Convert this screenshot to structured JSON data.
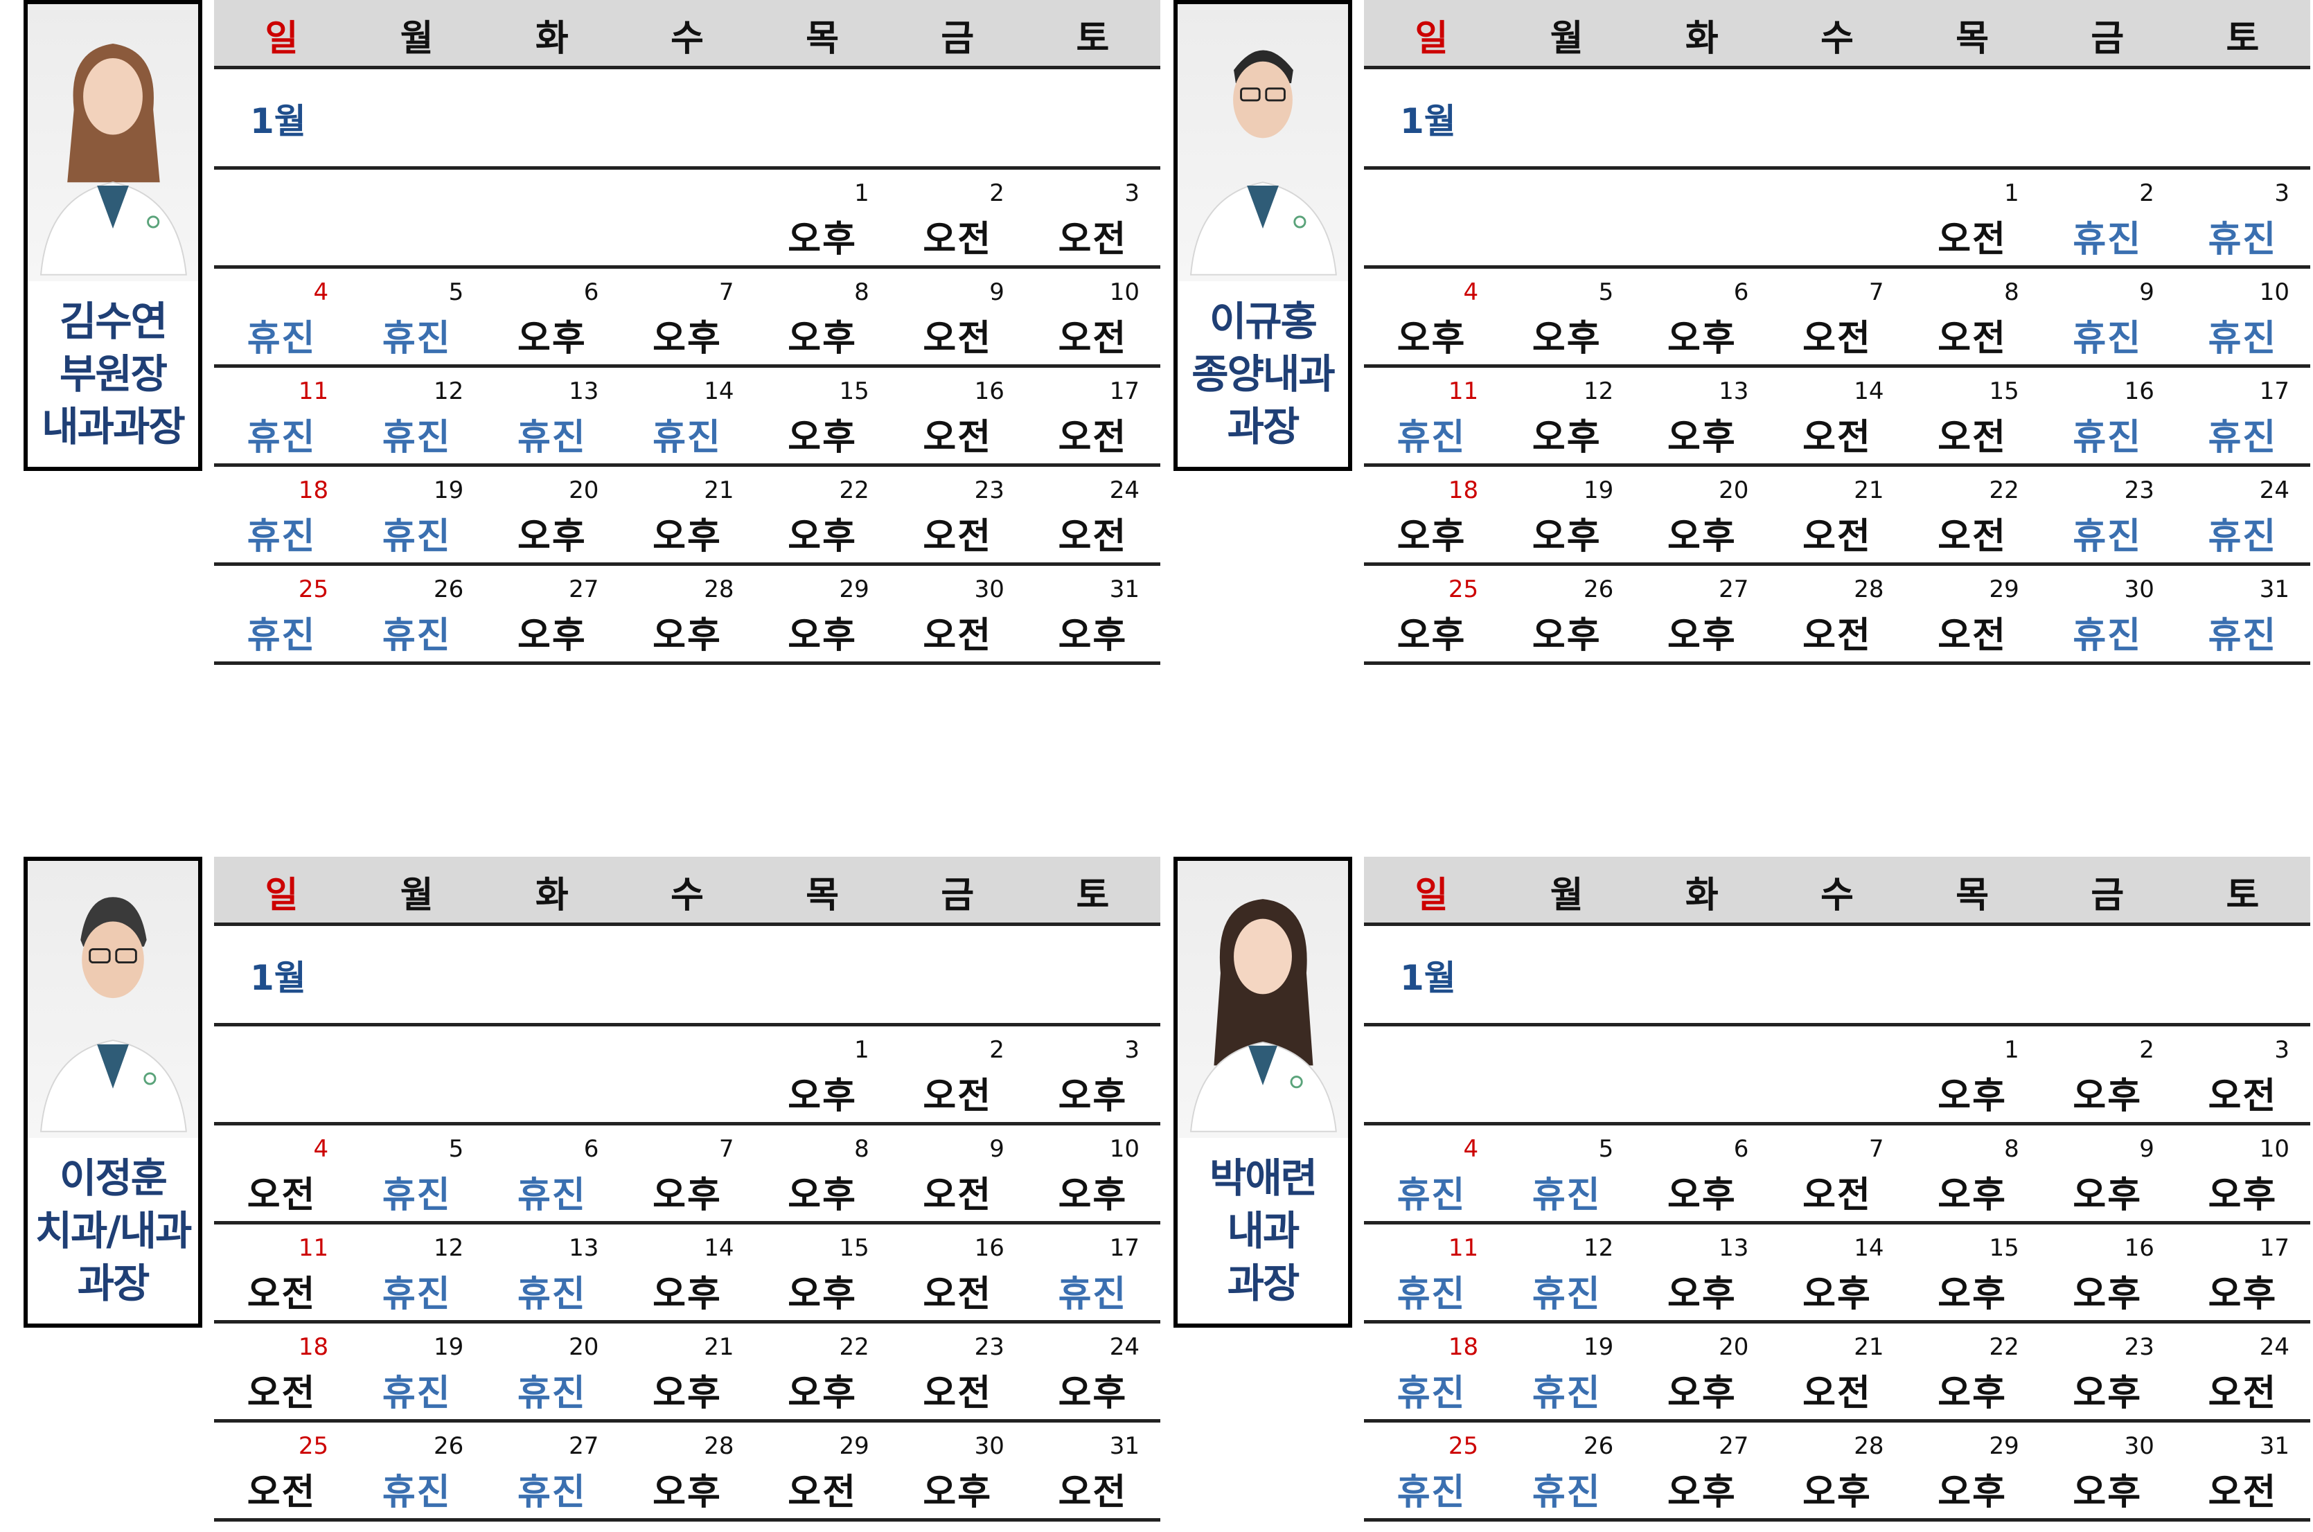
{
  "weekday_headers": [
    "일",
    "월",
    "화",
    "수",
    "목",
    "금",
    "토"
  ],
  "doctors": [
    {
      "name": "김수연\n부원장\n내과과장",
      "month": "1월",
      "weeks": [
        [
          null,
          null,
          null,
          null,
          {
            "day": "1",
            "shift": "오후"
          },
          {
            "day": "2",
            "shift": "오전"
          },
          {
            "day": "3",
            "shift": "오전"
          }
        ],
        [
          {
            "day": "4",
            "shift": "휴진"
          },
          {
            "day": "5",
            "shift": "휴진"
          },
          {
            "day": "6",
            "shift": "오후"
          },
          {
            "day": "7",
            "shift": "오후"
          },
          {
            "day": "8",
            "shift": "오후"
          },
          {
            "day": "9",
            "shift": "오전"
          },
          {
            "day": "10",
            "shift": "오전"
          }
        ],
        [
          {
            "day": "11",
            "shift": "휴진"
          },
          {
            "day": "12",
            "shift": "휴진"
          },
          {
            "day": "13",
            "shift": "휴진"
          },
          {
            "day": "14",
            "shift": "휴진"
          },
          {
            "day": "15",
            "shift": "오후"
          },
          {
            "day": "16",
            "shift": "오전"
          },
          {
            "day": "17",
            "shift": "오전"
          }
        ],
        [
          {
            "day": "18",
            "shift": "휴진"
          },
          {
            "day": "19",
            "shift": "휴진"
          },
          {
            "day": "20",
            "shift": "오후"
          },
          {
            "day": "21",
            "shift": "오후"
          },
          {
            "day": "22",
            "shift": "오후"
          },
          {
            "day": "23",
            "shift": "오전"
          },
          {
            "day": "24",
            "shift": "오전"
          }
        ],
        [
          {
            "day": "25",
            "shift": "휴진"
          },
          {
            "day": "26",
            "shift": "휴진"
          },
          {
            "day": "27",
            "shift": "오후"
          },
          {
            "day": "28",
            "shift": "오후"
          },
          {
            "day": "29",
            "shift": "오후"
          },
          {
            "day": "30",
            "shift": "오전"
          },
          {
            "day": "31",
            "shift": "오후"
          }
        ]
      ]
    },
    {
      "name": "이규홍\n종양내과\n과장",
      "month": "1월",
      "weeks": [
        [
          null,
          null,
          null,
          null,
          {
            "day": "1",
            "shift": "오전"
          },
          {
            "day": "2",
            "shift": "휴진"
          },
          {
            "day": "3",
            "shift": "휴진"
          }
        ],
        [
          {
            "day": "4",
            "shift": "오후"
          },
          {
            "day": "5",
            "shift": "오후"
          },
          {
            "day": "6",
            "shift": "오후"
          },
          {
            "day": "7",
            "shift": "오전"
          },
          {
            "day": "8",
            "shift": "오전"
          },
          {
            "day": "9",
            "shift": "휴진"
          },
          {
            "day": "10",
            "shift": "휴진"
          }
        ],
        [
          {
            "day": "11",
            "shift": "휴진"
          },
          {
            "day": "12",
            "shift": "오후"
          },
          {
            "day": "13",
            "shift": "오후"
          },
          {
            "day": "14",
            "shift": "오전"
          },
          {
            "day": "15",
            "shift": "오전"
          },
          {
            "day": "16",
            "shift": "휴진"
          },
          {
            "day": "17",
            "shift": "휴진"
          }
        ],
        [
          {
            "day": "18",
            "shift": "오후"
          },
          {
            "day": "19",
            "shift": "오후"
          },
          {
            "day": "20",
            "shift": "오후"
          },
          {
            "day": "21",
            "shift": "오전"
          },
          {
            "day": "22",
            "shift": "오전"
          },
          {
            "day": "23",
            "shift": "휴진"
          },
          {
            "day": "24",
            "shift": "휴진"
          }
        ],
        [
          {
            "day": "25",
            "shift": "오후"
          },
          {
            "day": "26",
            "shift": "오후"
          },
          {
            "day": "27",
            "shift": "오후"
          },
          {
            "day": "28",
            "shift": "오전"
          },
          {
            "day": "29",
            "shift": "오전"
          },
          {
            "day": "30",
            "shift": "휴진"
          },
          {
            "day": "31",
            "shift": "휴진"
          }
        ]
      ]
    },
    {
      "name": "이정훈\n치과/내과\n과장",
      "month": "1월",
      "weeks": [
        [
          null,
          null,
          null,
          null,
          {
            "day": "1",
            "shift": "오후"
          },
          {
            "day": "2",
            "shift": "오전"
          },
          {
            "day": "3",
            "shift": "오후"
          }
        ],
        [
          {
            "day": "4",
            "shift": "오전"
          },
          {
            "day": "5",
            "shift": "휴진"
          },
          {
            "day": "6",
            "shift": "휴진"
          },
          {
            "day": "7",
            "shift": "오후"
          },
          {
            "day": "8",
            "shift": "오후"
          },
          {
            "day": "9",
            "shift": "오전"
          },
          {
            "day": "10",
            "shift": "오후"
          }
        ],
        [
          {
            "day": "11",
            "shift": "오전"
          },
          {
            "day": "12",
            "shift": "휴진"
          },
          {
            "day": "13",
            "shift": "휴진"
          },
          {
            "day": "14",
            "shift": "오후"
          },
          {
            "day": "15",
            "shift": "오후"
          },
          {
            "day": "16",
            "shift": "오전"
          },
          {
            "day": "17",
            "shift": "휴진"
          }
        ],
        [
          {
            "day": "18",
            "shift": "오전"
          },
          {
            "day": "19",
            "shift": "휴진"
          },
          {
            "day": "20",
            "shift": "휴진"
          },
          {
            "day": "21",
            "shift": "오후"
          },
          {
            "day": "22",
            "shift": "오후"
          },
          {
            "day": "23",
            "shift": "오전"
          },
          {
            "day": "24",
            "shift": "오후"
          }
        ],
        [
          {
            "day": "25",
            "shift": "오전"
          },
          {
            "day": "26",
            "shift": "휴진"
          },
          {
            "day": "27",
            "shift": "휴진"
          },
          {
            "day": "28",
            "shift": "오후"
          },
          {
            "day": "29",
            "shift": "오전"
          },
          {
            "day": "30",
            "shift": "오후"
          },
          {
            "day": "31",
            "shift": "오전"
          }
        ]
      ]
    },
    {
      "name": "박애련\n내과\n과장",
      "month": "1월",
      "weeks": [
        [
          null,
          null,
          null,
          null,
          {
            "day": "1",
            "shift": "오후"
          },
          {
            "day": "2",
            "shift": "오후"
          },
          {
            "day": "3",
            "shift": "오전"
          }
        ],
        [
          {
            "day": "4",
            "shift": "휴진"
          },
          {
            "day": "5",
            "shift": "휴진"
          },
          {
            "day": "6",
            "shift": "오후"
          },
          {
            "day": "7",
            "shift": "오전"
          },
          {
            "day": "8",
            "shift": "오후"
          },
          {
            "day": "9",
            "shift": "오후"
          },
          {
            "day": "10",
            "shift": "오후"
          }
        ],
        [
          {
            "day": "11",
            "shift": "휴진"
          },
          {
            "day": "12",
            "shift": "휴진"
          },
          {
            "day": "13",
            "shift": "오후"
          },
          {
            "day": "14",
            "shift": "오후"
          },
          {
            "day": "15",
            "shift": "오후"
          },
          {
            "day": "16",
            "shift": "오후"
          },
          {
            "day": "17",
            "shift": "오후"
          }
        ],
        [
          {
            "day": "18",
            "shift": "휴진"
          },
          {
            "day": "19",
            "shift": "휴진"
          },
          {
            "day": "20",
            "shift": "오후"
          },
          {
            "day": "21",
            "shift": "오전"
          },
          {
            "day": "22",
            "shift": "오후"
          },
          {
            "day": "23",
            "shift": "오후"
          },
          {
            "day": "24",
            "shift": "오전"
          }
        ],
        [
          {
            "day": "25",
            "shift": "휴진"
          },
          {
            "day": "26",
            "shift": "휴진"
          },
          {
            "day": "27",
            "shift": "오후"
          },
          {
            "day": "28",
            "shift": "오후"
          },
          {
            "day": "29",
            "shift": "오후"
          },
          {
            "day": "30",
            "shift": "오후"
          },
          {
            "day": "31",
            "shift": "오전"
          }
        ]
      ]
    }
  ],
  "colors": {
    "sunday": "#cc0000",
    "off_day": "#3a6fb0",
    "work_day": "#111111",
    "name": "#1f3f75",
    "month": "#1f4e8c",
    "header_bg": "#d9d9d9"
  }
}
